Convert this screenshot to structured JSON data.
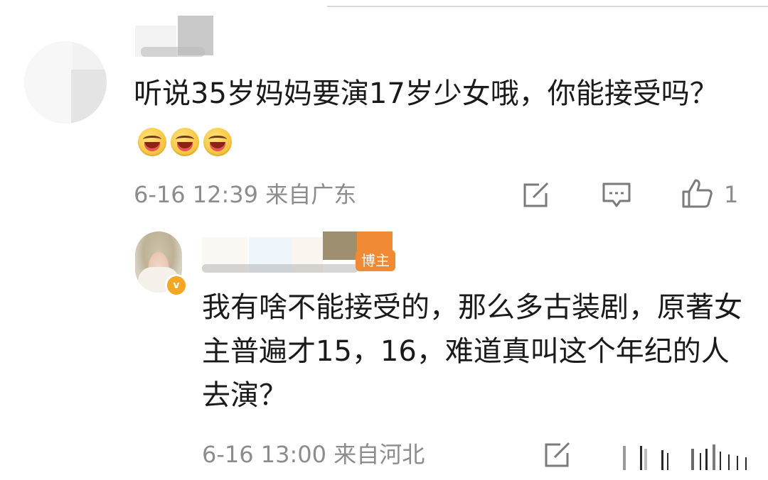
{
  "comment": {
    "text": "听说35岁妈妈要演17岁少女哦，你能接受吗？",
    "emojis": [
      "laugh-emoji",
      "laugh-emoji",
      "laugh-emoji"
    ],
    "time": "6-16 12:39",
    "location": "来自广东",
    "likes": "1"
  },
  "reply": {
    "badge_label": "博主",
    "verified_mark": "v",
    "text": "我有啥不能接受的，那么多古装剧，原著女主普遍才15，16，难道真叫这个年纪的人去演？",
    "time": "6-16 13:00",
    "location": "来自河北"
  },
  "colors": {
    "meta_gray": "#8c8c8c",
    "blogger_orange": "#f08a35",
    "verified_gold": "#f5a623"
  }
}
